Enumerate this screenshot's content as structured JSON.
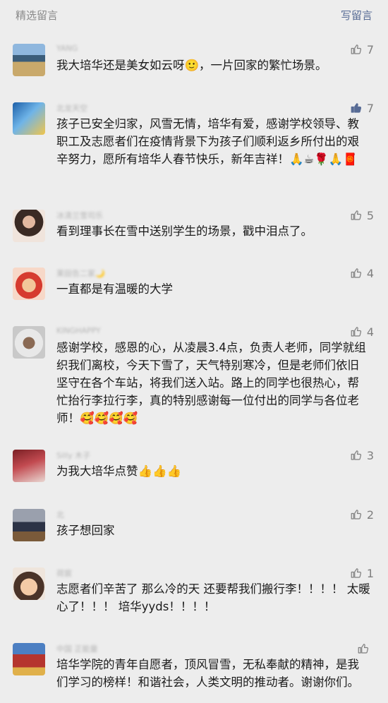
{
  "header": {
    "title": "精选留言",
    "write_label": "写留言"
  },
  "comments": [
    {
      "nickname": "YANG",
      "text": "我大培华还是美女如云呀🙂，一片回家的繁忙场景。",
      "likes": "7",
      "liked": false,
      "avatar": "photo-avatar"
    },
    {
      "nickname": "北龙天空",
      "text": "孩子已安全归家，风雪无情，培华有爱，感谢学校领导、教职工及志愿者们在疫情背景下为孩子们顺利返乡所付出的艰辛努力，愿所有培华人春节快乐，新年吉祥！🙏☕🌹🙏🧧",
      "likes": "7",
      "liked": true,
      "avatar": "photo-avatar"
    },
    {
      "nickname": "冰清兰雪司乐",
      "text": "看到理事长在雪中送别学生的场景，戳中泪点了。",
      "likes": "5",
      "liked": false,
      "avatar": "photo-avatar"
    },
    {
      "nickname": "莱田告二家🌙",
      "text": "一直都是有温暖的大学",
      "likes": "4",
      "liked": false,
      "avatar": "photo-avatar"
    },
    {
      "nickname": "KINGHAPPY",
      "text": "感谢学校，感恩的心，从凌晨3.4点，负责人老师，同学就组织我们离校，今天下雪了，天气特别寒冷，但是老师们依旧坚守在各个车站，将我们送入站。路上的同学也很热心，帮忙抬行李拉行李，真的特别感谢每一位付出的同学与各位老师！🥰🥰🥰🥰",
      "likes": "4",
      "liked": false,
      "avatar": "photo-avatar"
    },
    {
      "nickname": "Silly 木子",
      "text": "为我大培华点赞👍👍👍",
      "likes": "3",
      "liked": false,
      "avatar": "photo-avatar"
    },
    {
      "nickname": "北",
      "text": "孩子想回家",
      "likes": "2",
      "liked": false,
      "avatar": "photo-avatar"
    },
    {
      "nickname": "荷宸",
      "text": "志愿者们辛苦了 那么冷的天 还要帮我们搬行李！！！！ 太暖心了！！！ 培华yyds！！！！",
      "likes": "1",
      "liked": false,
      "avatar": "photo-avatar"
    },
    {
      "nickname": "中国 正能量",
      "text": "培华学院的青年自愿者，顶风冒雪，无私奉献的精神，是我们学习的榜样！和谐社会，人类文明的推动者。谢谢你们。",
      "likes": "",
      "liked": false,
      "avatar": "photo-avatar"
    }
  ],
  "icons": {
    "like": "thumbs-up-icon"
  },
  "colors": {
    "link": "#576b95",
    "background": "#ededed",
    "muted": "#8a8a8a"
  }
}
